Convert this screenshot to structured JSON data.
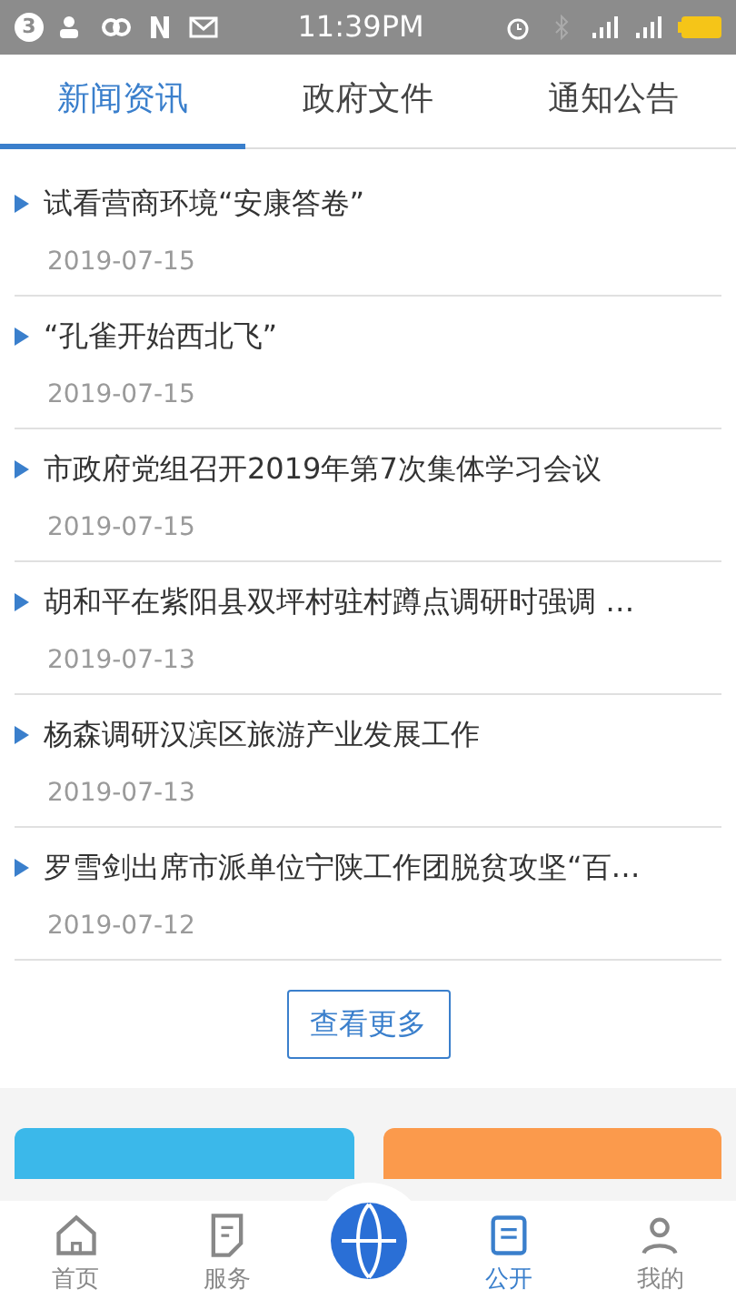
{
  "status_bar": {
    "notification_count": "3",
    "time": "11:39PM"
  },
  "tabs": [
    {
      "label": "新闻资讯",
      "selected": true
    },
    {
      "label": "政府文件",
      "selected": false
    },
    {
      "label": "通知公告",
      "selected": false
    }
  ],
  "news": [
    {
      "title": "试看营商环境“安康答卷”",
      "date": "2019-07-15"
    },
    {
      "title": "“孔雀开始西北飞”",
      "date": "2019-07-15"
    },
    {
      "title": "市政府党组召开2019年第7次集体学习会议",
      "date": "2019-07-15"
    },
    {
      "title": "胡和平在紫阳县双坪村驻村蹲点调研时强调 …",
      "date": "2019-07-13"
    },
    {
      "title": "杨森调研汉滨区旅游产业发展工作",
      "date": "2019-07-13"
    },
    {
      "title": "罗雪剑出席市派单位宁陕工作团脱贫攻坚“百…",
      "date": "2019-07-12"
    }
  ],
  "more_button": "查看更多",
  "feature_cards": [
    {
      "color": "#3bb8ea"
    },
    {
      "color": "#fb9a4c"
    }
  ],
  "bottom_nav": [
    {
      "kind": "home",
      "label": "首页",
      "selected": false
    },
    {
      "kind": "service",
      "label": "服务",
      "selected": false
    },
    {
      "kind": "center",
      "selected": false
    },
    {
      "kind": "public",
      "label": "公开",
      "selected": true
    },
    {
      "kind": "mine",
      "label": "我的",
      "selected": false
    }
  ]
}
